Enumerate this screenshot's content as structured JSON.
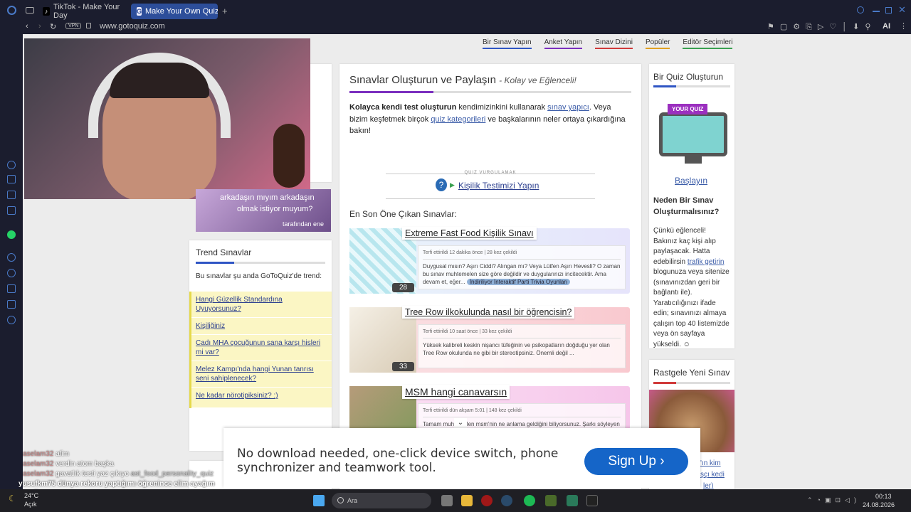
{
  "tabs": [
    {
      "label": "TikTok - Make Your Day"
    },
    {
      "label": "Make Your Own Quiz | Exp"
    }
  ],
  "address": {
    "vpn": "VPN",
    "url": "www.gotoquiz.com"
  },
  "nav": [
    "Bir Sınav Yapın",
    "Anket Yapın",
    "Sınav Dizini",
    "Popüler",
    "Editör Seçimleri"
  ],
  "main": {
    "title": "Sınavlar Oluşturun ve Paylaşın",
    "subtitle": "- Kolay ve Eğlenceli!",
    "intro_bold": "Kolayca kendi test oluşturun",
    "intro_1": " kendimizinkini kullanarak ",
    "intro_link1": "sınav yapıcı",
    "intro_2": ". Veya bizim keşfetmek birçok ",
    "intro_link2": "quiz kategorileri",
    "intro_3": " ve başkalarının neler ortaya çıkardığına bakın!",
    "highlight_label": "QUIZ VURGULAMAK",
    "highlight_link": "Kişilik Testimizi Yapın",
    "featured_heading": "En Son Öne Çıkan Sınavlar:",
    "cards": [
      {
        "title": "Extreme Fast Food Kişilik Sınavı",
        "meta": "Terfi ettirildi 12 dakika önce | 28 kez çekildi",
        "desc": "Duygusal mısın? Aşırı Ciddi? Alıngan mı? Veya Lütfen Aşırı Hevesli? O zaman bu sınav muhtemelen size göre değildir ve duygularınızı incitecektir. Ama devam et, eğer...",
        "tag": "İndiriliyor İnteraktif Parti Trivia Oyunları",
        "count": "28"
      },
      {
        "title": "Tree Row ilkokulunda nasıl bir öğrencisin?",
        "meta": "Terfi ettirildi 10 saat önce | 33 kez çekildi",
        "desc": "Yüksek kalibreli keskin nişancı tüfeğinin ve psikopatların doğduğu yer olan Tree Row okulunda ne gibi bir stereotipsiniz. Önemli değil ...",
        "tag": "",
        "count": "33"
      },
      {
        "title": "MSM hangi canavarsın",
        "meta": "Terfi ettirildi dün akşam 5:01 | 148 kez çekildi",
        "desc": "Tamam muhtemelen msm'nin ne anlama geldiğini biliyorsunuz. Şarkı söyleyen canavarlarım için argosu a ▣ oyun büyük mavi kabarcık tarafından yapılan bu size içinde şarkı canavar gösterir iyi eğlenceler! ...",
        "tag": "",
        "count": "148"
      }
    ]
  },
  "promo": {
    "line1": "arkadaşın mıyım arkadaşın",
    "line2": "olmak istiyor muyum?",
    "by": "tarafından ene"
  },
  "trending": {
    "title": "Trend Sınavlar",
    "desc": "Bu sınavlar şu anda GoToQuiz'de trend:",
    "items": [
      "Hangi Güzellik Standardına Uyuyorsunuz?",
      "Kişiliğiniz",
      "Cadı MHA çocuğunun sana karşı hisleri mi var?",
      "Melez Kampı'nda hangi Yunan tanrısı seni sahiplenecek?",
      "Ne kadar nörotipiksiniz? :)"
    ]
  },
  "create": {
    "title": "Bir Quiz Oluşturun",
    "badge": "YOUR QUIZ",
    "start": "Başlayın",
    "why": "Neden Bir Sınav Oluşturmalısınız?",
    "body_1": "Çünkü eğlenceli! Bakınız kaç kişi alıp paylaşacak. Hatta edebilirsin ",
    "body_link": "trafik getirin",
    "body_2": " blogunuza veya sitenize (sınavınızdan geri bir bağlantı ile). Yaratıcılığınızı ifade edin; sınavınızı almaya çalışın top 40 listemizde veya ön sayfaya yükseldi. ☺"
  },
  "random": {
    "title": "Rastgele Yeni Sınav",
    "link1": "'ın kim",
    "link2": "şçı kedi",
    "link3": "ler)"
  },
  "ad": {
    "text": "No download needed, one-click device switch, phone synchronizer and teamwork tool.",
    "button": "Sign Up ›"
  },
  "chat": [
    {
      "user": "aselam32",
      "msg": "afim"
    },
    {
      "user": "aselam32",
      "msg": "verdin atom başka"
    },
    {
      "user": "aselam32",
      "msg": "gavatlık testi yaz çıkıyo"
    },
    {
      "user": "yusufkm75",
      "msg": "dünya rekoru yaptığımı öğrenince elim ayağım titredi"
    }
  ],
  "overlay_url": "ast_food_personality_quiz",
  "taskbar": {
    "temp": "24°C",
    "weather": "Açık",
    "search": "Ara",
    "time": "00:13",
    "date": "24.08.2026"
  },
  "colors": {
    "accent": "#2d4e9a",
    "title_bar": "#7b2fbf",
    "link": "#2c3f8f",
    "ad_button": "#1565c8"
  }
}
